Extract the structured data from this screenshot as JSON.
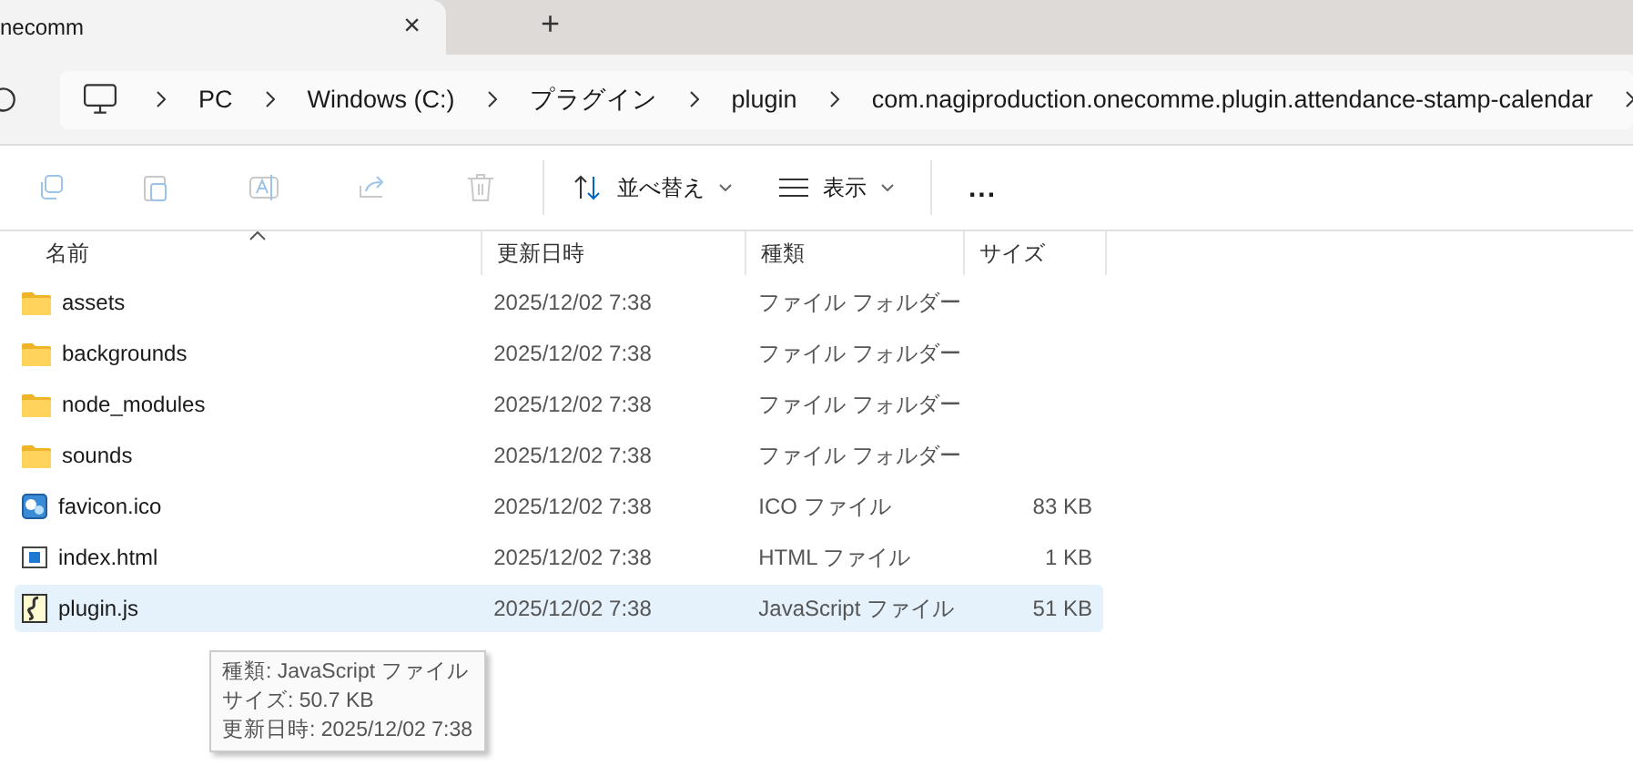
{
  "tab": {
    "title": "necomm",
    "close": "×",
    "new": "+"
  },
  "breadcrumb": [
    {
      "label": "PC"
    },
    {
      "label": "Windows (C:)"
    },
    {
      "label": "プラグイン"
    },
    {
      "label": "plugin"
    },
    {
      "label": "com.nagiproduction.onecomme.plugin.attendance-stamp-calendar"
    }
  ],
  "toolbar": {
    "sort": "並べ替え",
    "view": "表示",
    "more": "..."
  },
  "columns": [
    "名前",
    "更新日時",
    "種類",
    "サイズ"
  ],
  "rows": [
    {
      "name": "assets",
      "date": "2025/12/02 7:38",
      "type": "ファイル フォルダー",
      "kind": "folder",
      "selected": false
    },
    {
      "name": "backgrounds",
      "date": "2025/12/02 7:38",
      "type": "ファイル フォルダー",
      "kind": "folder",
      "selected": false
    },
    {
      "name": "node_modules",
      "date": "2025/12/02 7:38",
      "type": "ファイル フォルダー",
      "kind": "folder",
      "selected": false
    },
    {
      "name": "sounds",
      "date": "2025/12/02 7:38",
      "type": "ファイル フォルダー",
      "kind": "folder",
      "selected": false
    },
    {
      "name": "favicon.ico",
      "date": "2025/12/02 7:38",
      "type": "ICO ファイル",
      "size": "83 KB",
      "kind": "ico",
      "selected": false
    },
    {
      "name": "index.html",
      "date": "2025/12/02 7:38",
      "type": "HTML ファイル",
      "size": "1 KB",
      "kind": "html",
      "selected": false
    },
    {
      "name": "plugin.js",
      "date": "2025/12/02 7:38",
      "type": "JavaScript ファイル",
      "size": "51 KB",
      "kind": "js",
      "selected": true
    }
  ],
  "tooltip": [
    "種類: JavaScript ファイル",
    "サイズ: 50.7 KB",
    "更新日時: 2025/12/02 7:38"
  ]
}
